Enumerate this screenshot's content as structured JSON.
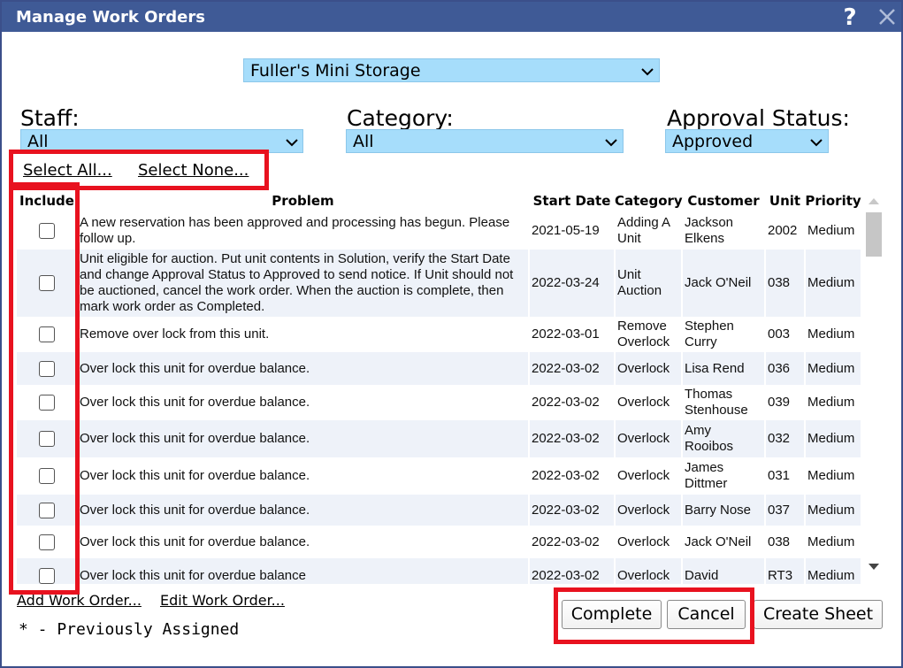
{
  "window": {
    "title": "Manage Work Orders",
    "help_icon": "question-mark-icon",
    "close_icon": "close-x-icon"
  },
  "facility": {
    "selected": "Fuller's Mini Storage"
  },
  "filters": {
    "staff": {
      "label": "Staff:",
      "selected": "All"
    },
    "category": {
      "label": "Category:",
      "selected": "All"
    },
    "approval": {
      "label": "Approval Status:",
      "selected": "Approved"
    }
  },
  "selection": {
    "select_all": "Select All...",
    "select_none": "Select None..."
  },
  "table": {
    "headers": {
      "include": "Include",
      "problem": "Problem",
      "start_date": "Start Date",
      "category": "Category",
      "customer": "Customer",
      "unit": "Unit",
      "priority": "Priority"
    },
    "rows": [
      {
        "problem": "A new reservation has been approved and processing has begun. Please follow up.",
        "start_date": "2021-05-19",
        "category": "Adding A Unit",
        "customer": "Jackson Elkens",
        "unit": "2002",
        "priority": "Medium"
      },
      {
        "problem": "Unit eligible for auction. Put unit contents in Solution, verify the Start Date and change Approval Status to Approved to send notice. If Unit should not be auctioned, cancel the work order. When the auction is complete, then mark work order as Completed.",
        "start_date": "2022-03-24",
        "category": "Unit Auction",
        "customer": "Jack O'Neil",
        "unit": "038",
        "priority": "Medium"
      },
      {
        "problem": "Remove over lock from this unit.",
        "start_date": "2022-03-01",
        "category": "Remove Overlock",
        "customer": "Stephen Curry",
        "unit": "003",
        "priority": "Medium"
      },
      {
        "problem": "Over lock this unit for overdue balance.",
        "start_date": "2022-03-02",
        "category": "Overlock",
        "customer": "Lisa Rend",
        "unit": "036",
        "priority": "Medium"
      },
      {
        "problem": "Over lock this unit for overdue balance.",
        "start_date": "2022-03-02",
        "category": "Overlock",
        "customer": "Thomas Stenhouse",
        "unit": "039",
        "priority": "Medium"
      },
      {
        "problem": "Over lock this unit for overdue balance.",
        "start_date": "2022-03-02",
        "category": "Overlock",
        "customer": "Amy Rooibos",
        "unit": "032",
        "priority": "Medium"
      },
      {
        "problem": "Over lock this unit for overdue balance.",
        "start_date": "2022-03-02",
        "category": "Overlock",
        "customer": "James Dittmer",
        "unit": "031",
        "priority": "Medium"
      },
      {
        "problem": "Over lock this unit for overdue balance.",
        "start_date": "2022-03-02",
        "category": "Overlock",
        "customer": "Barry Nose",
        "unit": "037",
        "priority": "Medium"
      },
      {
        "problem": "Over lock this unit for overdue balance.",
        "start_date": "2022-03-02",
        "category": "Overlock",
        "customer": "Jack O'Neil",
        "unit": "038",
        "priority": "Medium"
      },
      {
        "problem": "Over lock this unit for overdue balance",
        "start_date": "2022-03-02",
        "category": "Overlock",
        "customer": "David",
        "unit": "RT3",
        "priority": "Medium"
      }
    ]
  },
  "footer": {
    "add_work_order": "Add Work Order...",
    "edit_work_order": "Edit Work Order...",
    "legend": "* - Previously Assigned",
    "buttons": {
      "complete": "Complete",
      "cancel": "Cancel",
      "create_sheet": "Create Sheet"
    }
  },
  "colors": {
    "titlebar": "#3f5a96",
    "select_bg": "#a6ddfb",
    "highlight": "#e8121f",
    "row_alt": "#eef2f9"
  }
}
